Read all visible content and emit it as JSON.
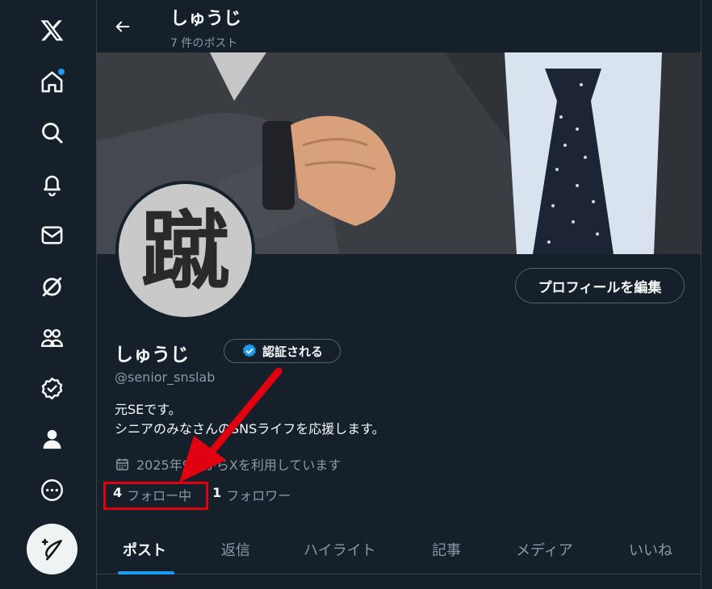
{
  "sidebar": {
    "items": [
      {
        "icon": "x-logo-icon"
      },
      {
        "icon": "home-icon",
        "has_notification_dot": true
      },
      {
        "icon": "search-icon"
      },
      {
        "icon": "bell-icon"
      },
      {
        "icon": "mail-icon"
      },
      {
        "icon": "grok-icon"
      },
      {
        "icon": "communities-icon"
      },
      {
        "icon": "verified-icon"
      },
      {
        "icon": "profile-icon"
      },
      {
        "icon": "more-icon"
      }
    ],
    "compose_icon": "compose-post-icon"
  },
  "header": {
    "back_icon": "back-arrow-icon",
    "name": "しゅうじ",
    "post_count": "7 件のポスト"
  },
  "profile": {
    "avatar_text": "蹴",
    "edit_button": "プロフィールを編集",
    "name": "しゅうじ",
    "verified_button": "認証される",
    "handle": "@senior_snslab",
    "bio_line1": "元SEです。",
    "bio_line2": "シニアのみなさんのSNSライフを応援します。",
    "joined": "2025年9月からXを利用しています",
    "following_count": "4",
    "following_label": "フォロー中",
    "followers_count": "1",
    "followers_label": "フォロワー"
  },
  "tabs": [
    "ポスト",
    "返信",
    "ハイライト",
    "記事",
    "メディア",
    "いいね"
  ],
  "active_tab": "ポスト",
  "colors": {
    "background": "#15202b",
    "accent": "#1d9bf0",
    "annotation": "#e0000f"
  }
}
